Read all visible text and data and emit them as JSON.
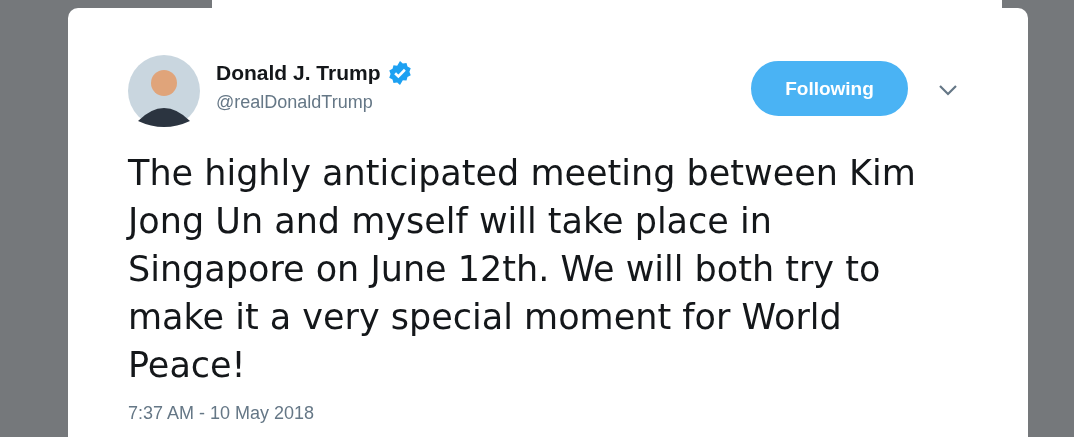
{
  "tweet": {
    "author": {
      "name": "Donald J. Trump",
      "verified": true,
      "handle": "@realDonaldTrump"
    },
    "follow_button": {
      "label": "Following",
      "on": true
    },
    "text": "The highly anticipated meeting between Kim Jong Un and myself will take place in Singapore on June 12th. We will both try to make it a very special moment for World Peace!",
    "timestamp": "7:37 AM - 10 May 2018"
  }
}
